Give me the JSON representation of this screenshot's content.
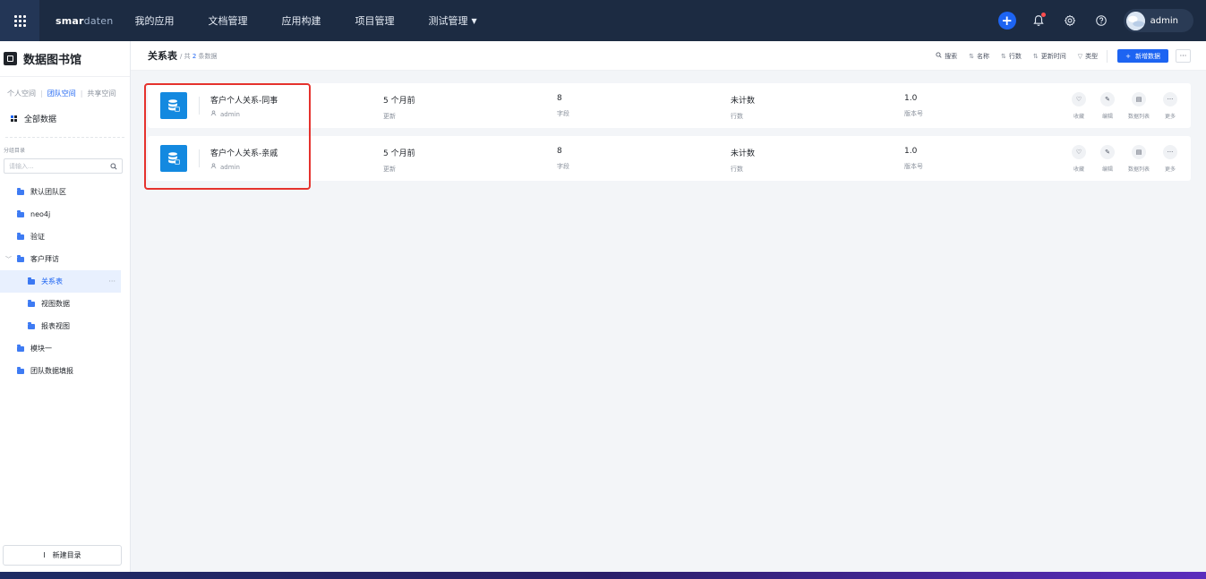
{
  "topbar": {
    "logo_bold": "smar",
    "logo_light": "daten",
    "nav": [
      "我的应用",
      "文档管理",
      "应用构建",
      "项目管理",
      "测试管理"
    ],
    "user": "admin"
  },
  "sidebar": {
    "title": "数据图书馆",
    "space_tabs": [
      "个人空间",
      "团队空间",
      "共享空间"
    ],
    "all_data": "全部数据",
    "category_label": "分组目录",
    "search_placeholder": "请输入...",
    "tree": [
      {
        "label": "默认团队区"
      },
      {
        "label": "neo4j"
      },
      {
        "label": "验证"
      },
      {
        "label": "客户拜访"
      },
      {
        "label": "关系表"
      },
      {
        "label": "视图数据"
      },
      {
        "label": "报表视图"
      },
      {
        "label": "模块一"
      },
      {
        "label": "团队数据填报"
      }
    ],
    "new_dir": "新建目录"
  },
  "main": {
    "title": "关系表",
    "sub_prefix": "/ 共",
    "count": "2",
    "sub_suffix": "条数据",
    "tools": {
      "search": "搜索",
      "name": "名称",
      "rows": "行数",
      "updated": "更新时间",
      "type": "类型",
      "add": "新增数据"
    }
  },
  "records": [
    {
      "name": "客户个人关系-同事",
      "owner": "admin",
      "updated": "5 个月前",
      "updated_label": "更新",
      "fields": "8",
      "fields_label": "字段",
      "rows": "未计数",
      "rows_label": "行数",
      "version": "1.0",
      "version_label": "版本号"
    },
    {
      "name": "客户个人关系-亲戚",
      "owner": "admin",
      "updated": "5 个月前",
      "updated_label": "更新",
      "fields": "8",
      "fields_label": "字段",
      "rows": "未计数",
      "rows_label": "行数",
      "version": "1.0",
      "version_label": "版本号"
    }
  ],
  "actions": [
    "收藏",
    "编辑",
    "数据列表",
    "更多"
  ],
  "icons": {
    "apps": "grid-icon",
    "add": "plus-icon",
    "bell": "bell-icon",
    "settings": "gear-icon",
    "help": "question-icon",
    "database": "database-icon"
  },
  "colors": {
    "topbar": "#1c2b42",
    "accent": "#1d64f2",
    "db_icon": "#1389e0",
    "highlight": "#e5322d"
  }
}
